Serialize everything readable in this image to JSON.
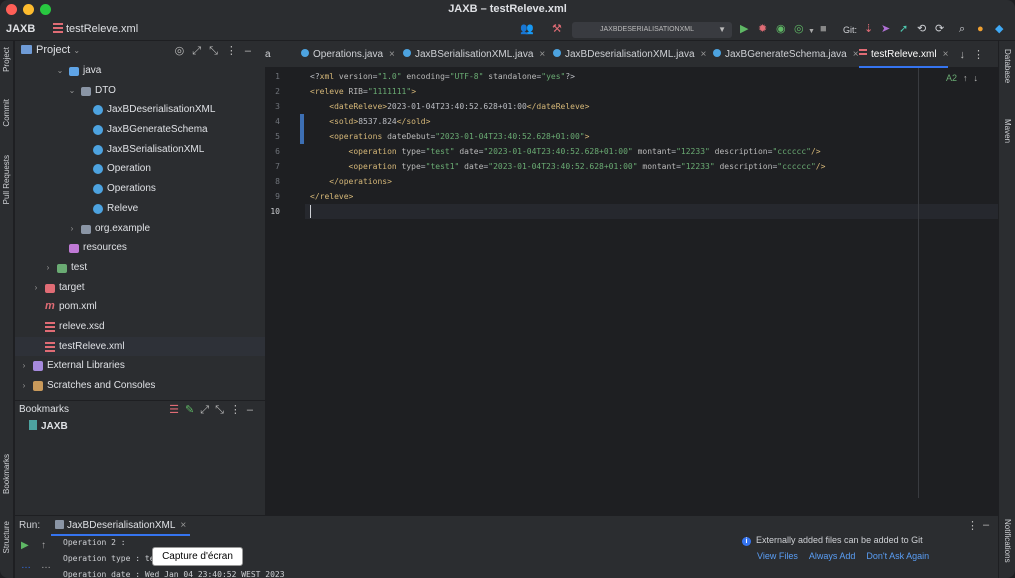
{
  "window": {
    "title": "JAXB – testReleve.xml"
  },
  "toolbar": {
    "project": "JAXB",
    "file": "testReleve.xml",
    "run_config": "JAXBDESERIALISATIONXML",
    "git_label": "Git:"
  },
  "left_strip": {
    "project": "Project",
    "commit": "Commit",
    "pull_requests": "Pull Requests",
    "bookmarks": "Bookmarks",
    "structure": "Structure"
  },
  "right_strip": {
    "database": "Database",
    "maven": "Maven",
    "notifications": "Notifications"
  },
  "project_panel": {
    "title": "Project",
    "tree": [
      {
        "label": "java",
        "icon": "source-folder-icon",
        "indent": 3,
        "arrow": "down"
      },
      {
        "label": "DTO",
        "icon": "package-icon",
        "indent": 4,
        "arrow": "down"
      },
      {
        "label": "JaxBDeserialisationXML",
        "icon": "class-icon",
        "indent": 5,
        "arrow": ""
      },
      {
        "label": "JaxBGenerateSchema",
        "icon": "class-icon",
        "indent": 5,
        "arrow": ""
      },
      {
        "label": "JaxBSerialisationXML",
        "icon": "class-icon",
        "indent": 5,
        "arrow": ""
      },
      {
        "label": "Operation",
        "icon": "class-icon",
        "indent": 5,
        "arrow": ""
      },
      {
        "label": "Operations",
        "icon": "class-icon",
        "indent": 5,
        "arrow": ""
      },
      {
        "label": "Releve",
        "icon": "class-icon",
        "indent": 5,
        "arrow": ""
      },
      {
        "label": "org.example",
        "icon": "package-icon",
        "indent": 4,
        "arrow": "right"
      },
      {
        "label": "resources",
        "icon": "resources-folder-icon",
        "indent": 3,
        "arrow": ""
      },
      {
        "label": "test",
        "icon": "test-folder-icon",
        "indent": 2,
        "arrow": "right"
      },
      {
        "label": "target",
        "icon": "target-folder-icon",
        "indent": 1,
        "arrow": "right"
      },
      {
        "label": "pom.xml",
        "icon": "maven-icon",
        "indent": 1,
        "arrow": ""
      },
      {
        "label": "releve.xsd",
        "icon": "xml-file-icon",
        "indent": 1,
        "arrow": ""
      },
      {
        "label": "testReleve.xml",
        "icon": "xml-file-icon",
        "indent": 1,
        "arrow": "",
        "selected": true
      },
      {
        "label": "External Libraries",
        "icon": "library-icon",
        "indent": 0,
        "arrow": "right"
      },
      {
        "label": "Scratches and Consoles",
        "icon": "scratches-icon",
        "indent": 0,
        "arrow": "right"
      }
    ]
  },
  "bookmarks": {
    "title": "Bookmarks",
    "item": "JAXB"
  },
  "tabs": [
    {
      "label": "a",
      "icon": "none",
      "close": ""
    },
    {
      "label": "Operations.java",
      "icon": "class",
      "close": "×"
    },
    {
      "label": "JaxBSerialisationXML.java",
      "icon": "class",
      "close": "×"
    },
    {
      "label": "JaxBDeserialisationXML.java",
      "icon": "class",
      "close": "×"
    },
    {
      "label": "JaxBGenerateSchema.java",
      "icon": "class",
      "close": "×"
    },
    {
      "label": "testReleve.xml",
      "icon": "xml",
      "close": "×",
      "active": true
    }
  ],
  "editor": {
    "hint": "2",
    "line_numbers": [
      "1",
      "2",
      "3",
      "4",
      "5",
      "6",
      "7",
      "8",
      "9",
      "10"
    ],
    "lines": [
      [
        [
          "c-pi",
          "<?"
        ],
        [
          "c-tag",
          "xml "
        ],
        [
          "c-attr",
          "version"
        ],
        [
          "c-pi",
          "="
        ],
        [
          "c-val",
          "\"1.0\" "
        ],
        [
          "c-attr",
          "encoding"
        ],
        [
          "c-pi",
          "="
        ],
        [
          "c-val",
          "\"UTF-8\" "
        ],
        [
          "c-attr",
          "standalone"
        ],
        [
          "c-pi",
          "="
        ],
        [
          "c-val",
          "\"yes\""
        ],
        [
          "c-pi",
          "?>"
        ]
      ],
      [
        [
          "c-br",
          "<"
        ],
        [
          "c-tag",
          "releve "
        ],
        [
          "c-attr",
          "RIB"
        ],
        [
          "c-pi",
          "="
        ],
        [
          "c-val",
          "\"1111111\""
        ],
        [
          "c-br",
          ">"
        ]
      ],
      [
        [
          "c-txt",
          "    "
        ],
        [
          "c-br",
          "<"
        ],
        [
          "c-tag",
          "dateReleve"
        ],
        [
          "c-br",
          ">"
        ],
        [
          "c-txt",
          "2023-01-04T23:40:52.628+01:00"
        ],
        [
          "c-br",
          "</"
        ],
        [
          "c-tag",
          "dateReleve"
        ],
        [
          "c-br",
          ">"
        ]
      ],
      [
        [
          "c-txt",
          "    "
        ],
        [
          "c-br",
          "<"
        ],
        [
          "c-tag",
          "sold"
        ],
        [
          "c-br",
          ">"
        ],
        [
          "c-txt",
          "8537.824"
        ],
        [
          "c-br",
          "</"
        ],
        [
          "c-tag",
          "sold"
        ],
        [
          "c-br",
          ">"
        ]
      ],
      [
        [
          "c-txt",
          "    "
        ],
        [
          "c-br",
          "<"
        ],
        [
          "c-tag",
          "operations "
        ],
        [
          "c-attr",
          "dateDebut"
        ],
        [
          "c-pi",
          "="
        ],
        [
          "c-val",
          "\"2023-01-04T23:40:52.628+01:00\""
        ],
        [
          "c-br",
          ">"
        ]
      ],
      [
        [
          "c-txt",
          "        "
        ],
        [
          "c-br",
          "<"
        ],
        [
          "c-tag",
          "operation "
        ],
        [
          "c-attr",
          "type"
        ],
        [
          "c-pi",
          "="
        ],
        [
          "c-val",
          "\"test\" "
        ],
        [
          "c-attr",
          "date"
        ],
        [
          "c-pi",
          "="
        ],
        [
          "c-val",
          "\"2023-01-04T23:40:52.628+01:00\" "
        ],
        [
          "c-attr",
          "montant"
        ],
        [
          "c-pi",
          "="
        ],
        [
          "c-val",
          "\"12233\" "
        ],
        [
          "c-attr",
          "description"
        ],
        [
          "c-pi",
          "="
        ],
        [
          "c-val",
          "\"cccccc\""
        ],
        [
          "c-br",
          "/>"
        ]
      ],
      [
        [
          "c-txt",
          "        "
        ],
        [
          "c-br",
          "<"
        ],
        [
          "c-tag",
          "operation "
        ],
        [
          "c-attr",
          "type"
        ],
        [
          "c-pi",
          "="
        ],
        [
          "c-val",
          "\"test1\" "
        ],
        [
          "c-attr",
          "date"
        ],
        [
          "c-pi",
          "="
        ],
        [
          "c-val",
          "\"2023-01-04T23:40:52.628+01:00\" "
        ],
        [
          "c-attr",
          "montant"
        ],
        [
          "c-pi",
          "="
        ],
        [
          "c-val",
          "\"12233\" "
        ],
        [
          "c-attr",
          "description"
        ],
        [
          "c-pi",
          "="
        ],
        [
          "c-val",
          "\"cccccc\""
        ],
        [
          "c-br",
          "/>"
        ]
      ],
      [
        [
          "c-txt",
          "    "
        ],
        [
          "c-br",
          "</"
        ],
        [
          "c-tag",
          "operations"
        ],
        [
          "c-br",
          ">"
        ]
      ],
      [
        [
          "c-br",
          "</"
        ],
        [
          "c-tag",
          "releve"
        ],
        [
          "c-br",
          ">"
        ]
      ],
      []
    ]
  },
  "run_panel": {
    "label": "Run:",
    "tab": "JaxBDeserialisationXML",
    "console": [
      "Operation 2 :",
      "Operation type : test1",
      "Operation date : Wed Jan 04 23:40:52 WEST 2023"
    ]
  },
  "tooltip": "Capture d'écran",
  "notification": {
    "text": "Externally added files can be added to Git",
    "actions": [
      "View Files",
      "Always Add",
      "Don't Ask Again"
    ]
  },
  "colors": {
    "accent": "#3574f0",
    "xml_tag": "#d5b778",
    "xml_value": "#6aab73",
    "background": "#1e1f22",
    "panel": "#2b2d30"
  }
}
